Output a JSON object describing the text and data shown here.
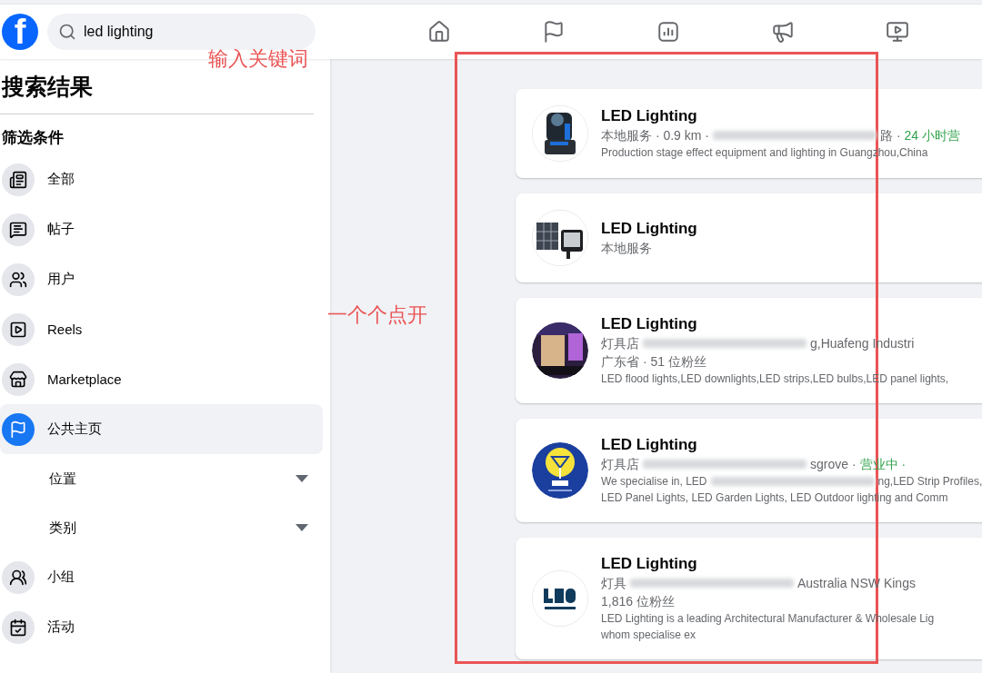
{
  "top_bar": {
    "logo": "f",
    "search": {
      "value": "led lighting"
    }
  },
  "sidebar": {
    "title": "搜索结果",
    "filters_heading": "筛选条件",
    "items": [
      {
        "label": "全部",
        "selected": false
      },
      {
        "label": "帖子",
        "selected": false
      },
      {
        "label": "用户",
        "selected": false
      },
      {
        "label": "Reels",
        "selected": false
      },
      {
        "label": "Marketplace",
        "selected": false
      },
      {
        "label": "公共主页",
        "selected": true,
        "children": [
          {
            "label": "位置"
          },
          {
            "label": "类别"
          }
        ]
      },
      {
        "label": "小组",
        "selected": false
      },
      {
        "label": "活动",
        "selected": false
      }
    ]
  },
  "results": [
    {
      "title": "LED Lighting",
      "lines": [
        {
          "kind": "meta",
          "segments": [
            {
              "kind": "text",
              "text": "本地服务 · 0.9 km ·"
            },
            {
              "kind": "blur"
            },
            {
              "kind": "text",
              "text": "路 ·"
            },
            {
              "kind": "open",
              "text": "24 小时营"
            }
          ]
        },
        {
          "kind": "desc",
          "segments": [
            {
              "kind": "text",
              "text": "Production stage effect equipment and lighting in Guangzhou,China"
            }
          ]
        }
      ]
    },
    {
      "title": "LED Lighting",
      "lines": [
        {
          "kind": "meta",
          "segments": [
            {
              "kind": "text",
              "text": "本地服务"
            }
          ]
        }
      ]
    },
    {
      "title": "LED Lighting",
      "lines": [
        {
          "kind": "meta",
          "segments": [
            {
              "kind": "text",
              "text": "灯具店"
            },
            {
              "kind": "blur"
            },
            {
              "kind": "text",
              "text": "g,Huafeng Industri"
            }
          ]
        },
        {
          "kind": "meta",
          "segments": [
            {
              "kind": "text",
              "text": "广东省 · 51 位粉丝"
            }
          ]
        },
        {
          "kind": "desc",
          "segments": [
            {
              "kind": "text",
              "text": "LED flood lights,LED downlights,LED strips,LED bulbs,LED panel lights,"
            }
          ]
        }
      ]
    },
    {
      "title": "LED Lighting",
      "lines": [
        {
          "kind": "meta",
          "segments": [
            {
              "kind": "text",
              "text": "灯具店"
            },
            {
              "kind": "blur"
            },
            {
              "kind": "text",
              "text": "sgrove ·"
            },
            {
              "kind": "open",
              "text": "营业中 ·"
            }
          ]
        },
        {
          "kind": "desc",
          "segments": [
            {
              "kind": "text",
              "text": "We specialise in, LED"
            },
            {
              "kind": "blur"
            },
            {
              "kind": "text",
              "text": "ng,LED Strip Profiles,"
            }
          ]
        },
        {
          "kind": "desc",
          "segments": [
            {
              "kind": "text",
              "text": "LED Panel Lights, LED Garden Lights, LED Outdoor lighting and Comm"
            }
          ]
        }
      ]
    },
    {
      "title": "LED Lighting",
      "lines": [
        {
          "kind": "meta",
          "segments": [
            {
              "kind": "text",
              "text": "灯具"
            },
            {
              "kind": "blur"
            },
            {
              "kind": "text",
              "text": "Australia NSW Kings"
            }
          ]
        },
        {
          "kind": "meta",
          "segments": [
            {
              "kind": "text",
              "text": "1,816 位粉丝"
            }
          ]
        },
        {
          "kind": "desc",
          "segments": [
            {
              "kind": "text",
              "text": "LED Lighting is a leading Architectural Manufacturer & Wholesale Lig"
            }
          ]
        },
        {
          "kind": "desc",
          "segments": [
            {
              "kind": "text",
              "text": "whom specialise ex"
            }
          ]
        }
      ]
    }
  ],
  "annotations": [
    {
      "text": "输入关键词"
    },
    {
      "text": "一个个点开"
    }
  ]
}
